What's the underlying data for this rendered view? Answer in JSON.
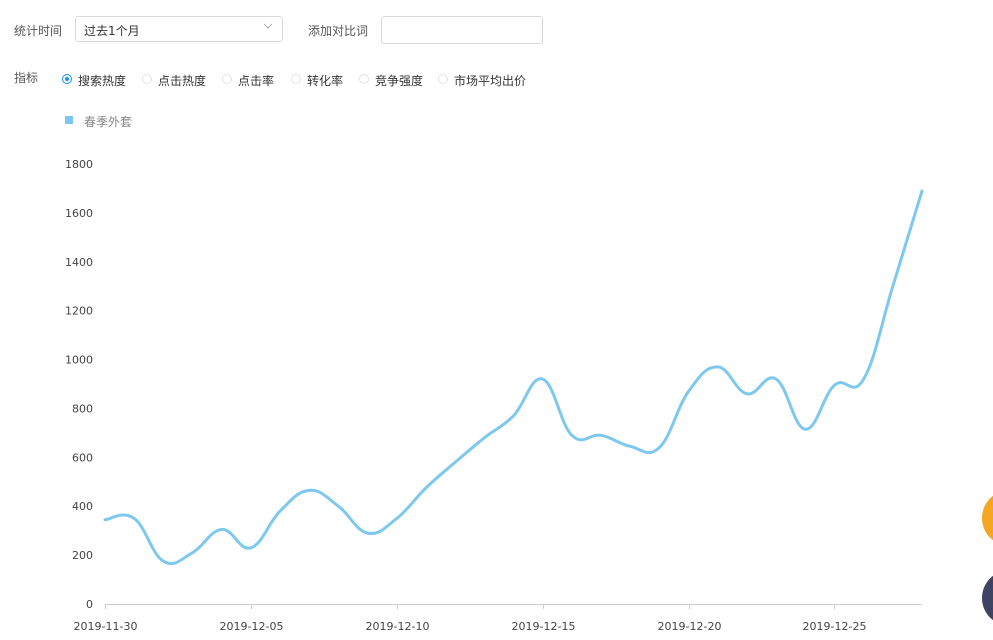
{
  "filters": {
    "period_label": "统计时间",
    "period_value": "过去1个月",
    "compare_label": "添加对比词",
    "compare_value": ""
  },
  "metrics": {
    "label": "指标",
    "options": [
      "搜索热度",
      "点击热度",
      "点击率",
      "转化率",
      "竞争强度",
      "市场平均出价"
    ],
    "selected": "搜索热度"
  },
  "colors": {
    "series": "#7ec8ef",
    "radio_active": "#1890ff",
    "fab_orange": "#f5a623",
    "fab_navy": "#3e4461"
  },
  "chart_data": {
    "type": "line",
    "title": "",
    "xlabel": "",
    "ylabel": "",
    "ylim": [
      0,
      1800
    ],
    "yticks": [
      0,
      200,
      400,
      600,
      800,
      1000,
      1200,
      1400,
      1600,
      1800
    ],
    "xticks": [
      "2019-11-30",
      "2019-12-05",
      "2019-12-10",
      "2019-12-15",
      "2019-12-20",
      "2019-12-25"
    ],
    "legend_position": "top-left",
    "grid": false,
    "x": [
      "2019-11-30",
      "2019-12-01",
      "2019-12-02",
      "2019-12-03",
      "2019-12-04",
      "2019-12-05",
      "2019-12-06",
      "2019-12-07",
      "2019-12-08",
      "2019-12-09",
      "2019-12-10",
      "2019-12-11",
      "2019-12-12",
      "2019-12-13",
      "2019-12-14",
      "2019-12-15",
      "2019-12-16",
      "2019-12-17",
      "2019-12-18",
      "2019-12-19",
      "2019-12-20",
      "2019-12-21",
      "2019-12-22",
      "2019-12-23",
      "2019-12-24",
      "2019-12-25",
      "2019-12-26",
      "2019-12-27",
      "2019-12-28"
    ],
    "series": [
      {
        "name": "春季外套",
        "values": [
          345,
          350,
          175,
          210,
          305,
          230,
          380,
          465,
          400,
          290,
          350,
          475,
          580,
          680,
          770,
          920,
          690,
          690,
          645,
          640,
          870,
          970,
          860,
          920,
          715,
          895,
          920,
          1300,
          1690
        ]
      }
    ]
  }
}
